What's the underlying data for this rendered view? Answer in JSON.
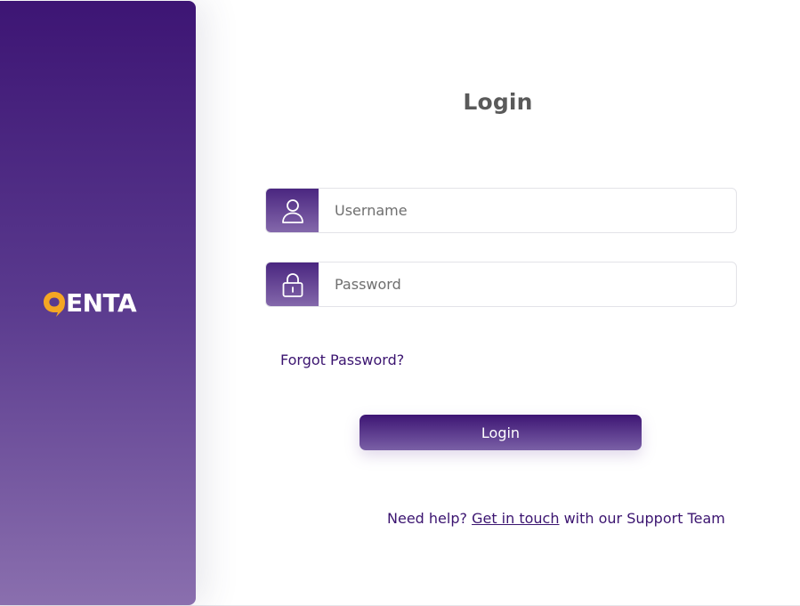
{
  "brand": {
    "logo_text": "ENTA",
    "accent_color": "#f5a623",
    "primary_color": "#3d1574"
  },
  "form": {
    "title": "Login",
    "username": {
      "placeholder": "Username",
      "value": "",
      "icon": "user-icon"
    },
    "password": {
      "placeholder": "Password",
      "value": "",
      "icon": "lock-icon"
    },
    "forgot_label": "Forgot Password?",
    "submit_label": "Login"
  },
  "help": {
    "prefix": "Need help?",
    "link_label": "Get in touch",
    "suffix": "with our Support Team"
  }
}
